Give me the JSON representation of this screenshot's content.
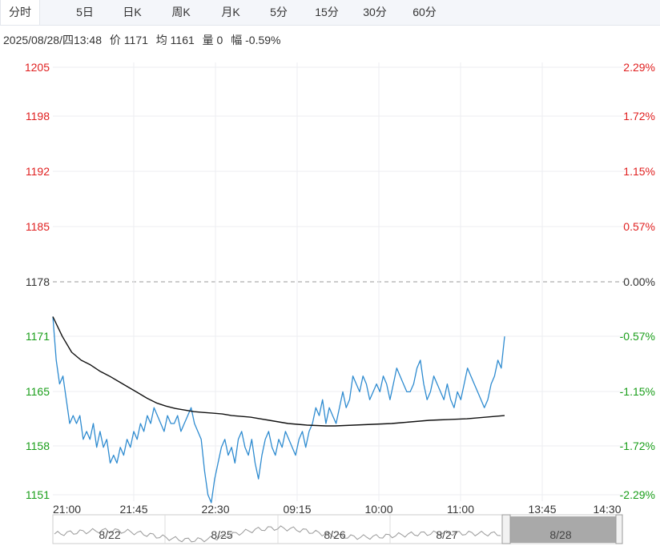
{
  "tabs": [
    {
      "label": "分时",
      "active": true
    },
    {
      "label": "5日"
    },
    {
      "label": "日K"
    },
    {
      "label": "周K"
    },
    {
      "label": "月K"
    },
    {
      "label": "5分"
    },
    {
      "label": "15分"
    },
    {
      "label": "30分"
    },
    {
      "label": "60分"
    }
  ],
  "info": {
    "datetime": "2025/08/28/四13:48",
    "price": "价 1171",
    "avg": "均 1161",
    "volume": "量 0",
    "change": "幅 -0.59%"
  },
  "colors": {
    "up": "#e02020",
    "down": "#1a9e1a",
    "neutral": "#333333",
    "price_line": "#2e8bd0",
    "avg_line": "#111111"
  },
  "chart_data": {
    "type": "line",
    "ylim": [
      1151,
      1205
    ],
    "base_price": 1178,
    "left_ticks": [
      "1205",
      "1198",
      "1192",
      "1185",
      "1178",
      "1171",
      "1165",
      "1158",
      "1151"
    ],
    "right_ticks": [
      "2.29%",
      "1.72%",
      "1.15%",
      "0.57%",
      "0.00%",
      "-0.57%",
      "-1.15%",
      "-1.72%",
      "-2.29%"
    ],
    "x_ticks": [
      "21:00",
      "21:45",
      "22:30",
      "09:15",
      "10:00",
      "11:00",
      "13:45",
      "14:30"
    ],
    "series": [
      {
        "key": "price",
        "values": [
          1173.5,
          1168,
          1165,
          1166,
          1163,
          1160,
          1161,
          1160,
          1161,
          1158,
          1159,
          1158,
          1160,
          1157,
          1159,
          1157,
          1158,
          1155,
          1156,
          1155,
          1157,
          1156,
          1158,
          1157,
          1159,
          1158,
          1160,
          1159,
          1161,
          1160,
          1162,
          1161,
          1160,
          1159,
          1161,
          1160,
          1160,
          1161,
          1159,
          1160,
          1161,
          1162,
          1160,
          1159,
          1158,
          1154,
          1151,
          1150,
          1153,
          1155,
          1157,
          1158,
          1156,
          1157,
          1155,
          1158,
          1159,
          1157,
          1156,
          1158,
          1155,
          1153,
          1156,
          1158,
          1159,
          1157,
          1156,
          1158,
          1157,
          1159,
          1158,
          1157,
          1156,
          1158,
          1159,
          1157,
          1159,
          1160,
          1162,
          1161,
          1163,
          1160,
          1162,
          1161,
          1160,
          1162,
          1164,
          1162,
          1163,
          1166,
          1165,
          1164,
          1166,
          1165,
          1163,
          1164,
          1165,
          1164,
          1166,
          1165,
          1163,
          1165,
          1167,
          1166,
          1165,
          1164,
          1164,
          1165,
          1167,
          1168,
          1165,
          1163,
          1164,
          1166,
          1165,
          1164,
          1163,
          1165,
          1163,
          1162,
          1164,
          1163,
          1165,
          1167,
          1166,
          1165,
          1164,
          1163,
          1162,
          1163,
          1165,
          1166,
          1168,
          1167,
          1171
        ],
        "x_range": [
          0,
          134
        ]
      },
      {
        "key": "avg",
        "values": [
          1173.5,
          1171,
          1169,
          1168,
          1167.4,
          1166.6,
          1166,
          1165.3,
          1164.6,
          1163.9,
          1163.2,
          1162.6,
          1162.2,
          1161.9,
          1161.7,
          1161.5,
          1161.4,
          1161.3,
          1161.2,
          1161.0,
          1160.9,
          1160.8,
          1160.6,
          1160.4,
          1160.2,
          1160.0,
          1159.9,
          1159.8,
          1159.75,
          1159.7,
          1159.7,
          1159.75,
          1159.8,
          1159.85,
          1159.9,
          1159.95,
          1160.0,
          1160.1,
          1160.2,
          1160.3,
          1160.4,
          1160.45,
          1160.5,
          1160.55,
          1160.6,
          1160.7,
          1160.8,
          1160.9,
          1161.0
        ],
        "x_range": [
          0,
          134
        ]
      }
    ]
  },
  "navigator": {
    "dates": [
      "8/22",
      "8/25",
      "8/26",
      "8/27",
      "8/28"
    ]
  }
}
